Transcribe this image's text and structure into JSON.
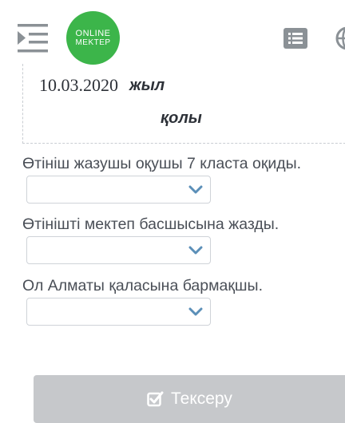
{
  "header": {
    "logo": {
      "line1": "ONLINE",
      "line2": "MEKTEP"
    },
    "icons": [
      "menu-icon",
      "list-icon",
      "globe-icon"
    ]
  },
  "document": {
    "date": "10.03.2020",
    "year_word": "жыл",
    "signature_label": "қолы"
  },
  "questions": [
    {
      "text": "Өтініш жазушы оқушы 7 класта оқиды.",
      "selected": ""
    },
    {
      "text": "Өтінішті мектеп басшысына жазды.",
      "selected": ""
    },
    {
      "text": "Ол Алматы қаласына бармақшы.",
      "selected": ""
    }
  ],
  "check_button": {
    "label": "Тексеру",
    "icon": "check-square-icon"
  },
  "colors": {
    "brand": "#3cb54a",
    "icon_gray": "#8b9196",
    "accent_chevron": "#5b8fb8",
    "button_disabled": "#c6c8cb"
  }
}
